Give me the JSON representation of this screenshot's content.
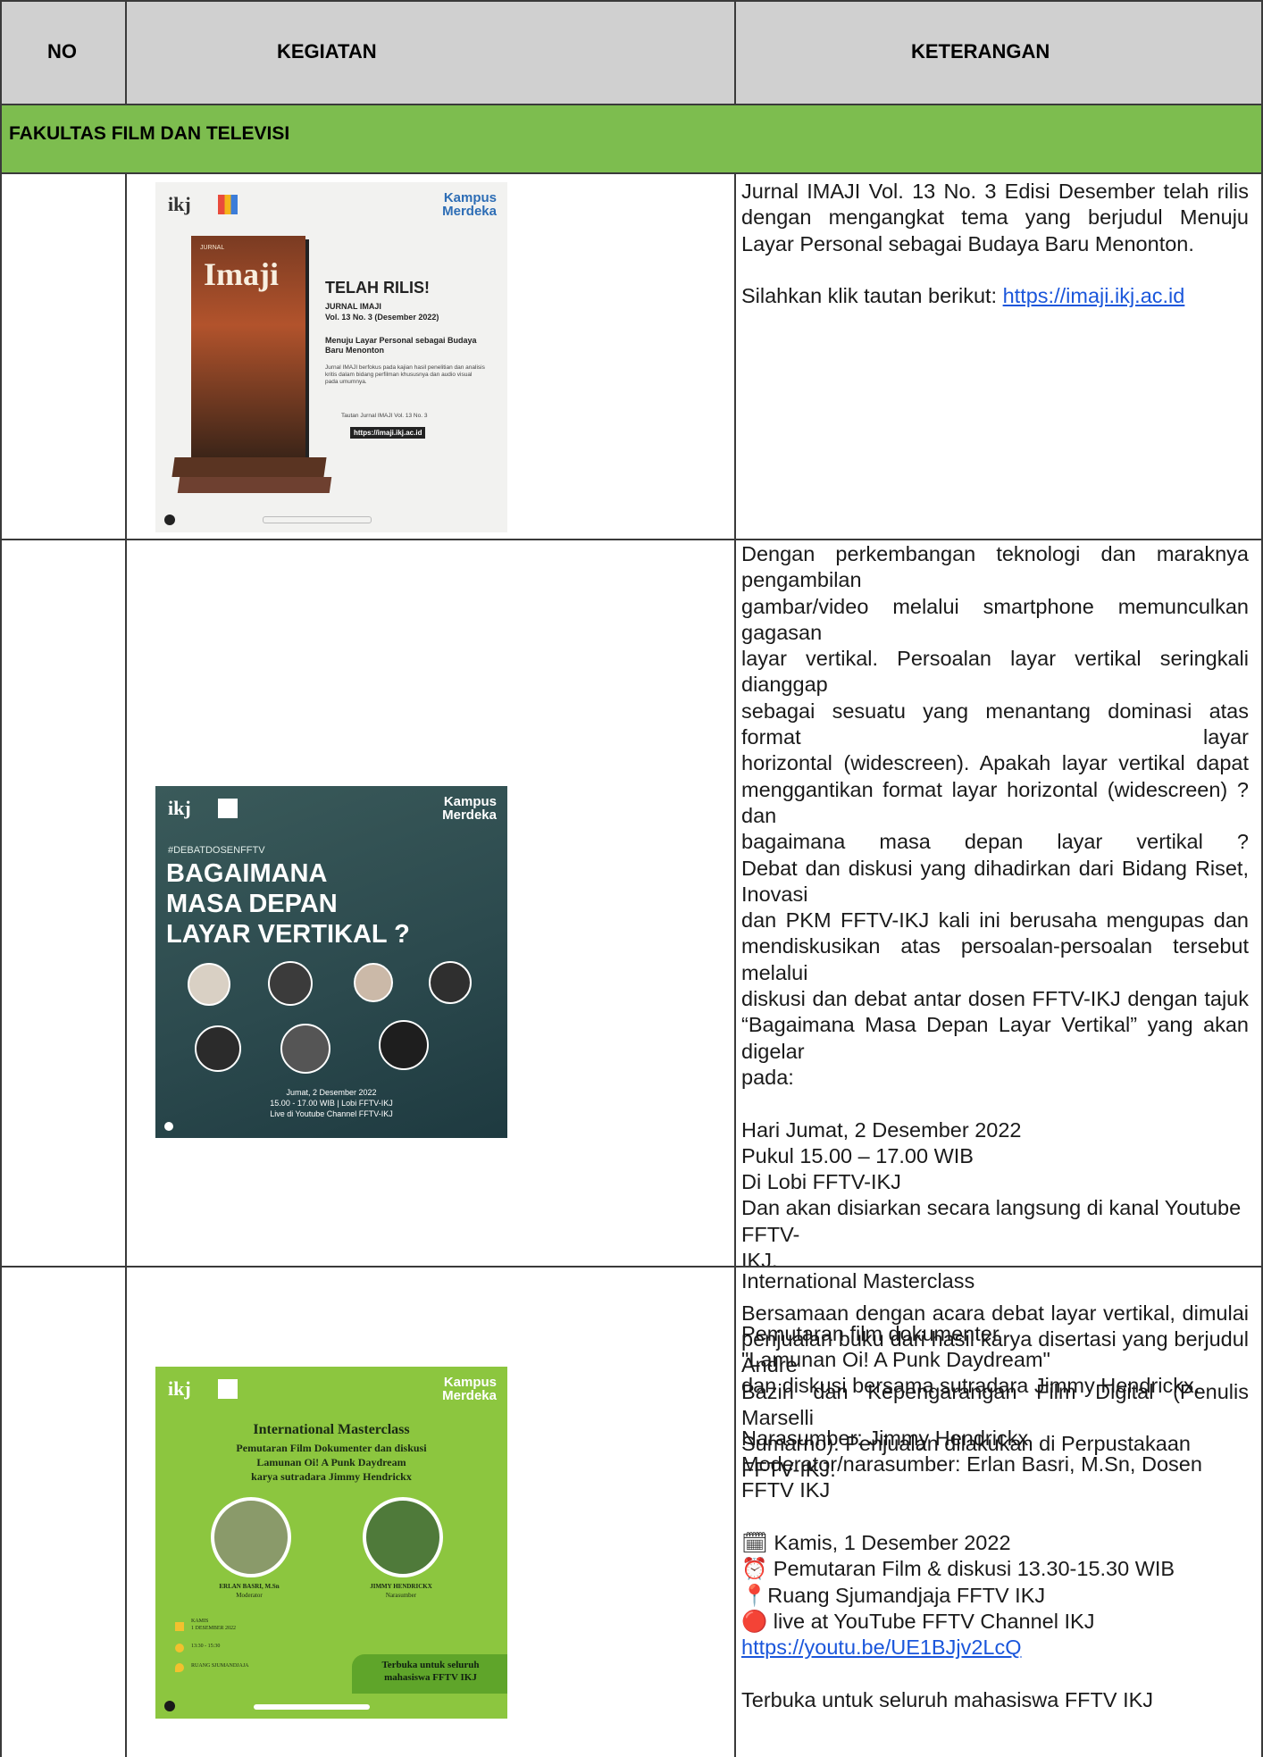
{
  "header": {
    "no": "NO",
    "kegiatan": "KEGIATAN",
    "keterangan": "KETERANGAN"
  },
  "section": {
    "title": "FAKULTAS FILM DAN TELEVISI"
  },
  "row1": {
    "para": "Jurnal IMAJI Vol. 13 No. 3 Edisi Desember telah rilis dengan mengangkat tema yang berjudul Menuju Layar Personal sebagai Budaya Baru Menonton.",
    "link_prefix": "Silahkan klik tautan berikut: ",
    "link": "https://imaji.ikj.ac.id",
    "poster": {
      "logo": "ikj",
      "badge_top": "Kampus",
      "badge_bottom": "Merdeka",
      "journal_small": "JURNAL",
      "journal_title": "Imaji",
      "headline": "TELAH RILIS!",
      "sub1": "JURNAL IMAJI",
      "sub2": "Vol. 13 No. 3 (Desember 2022)",
      "theme": "Menuju Layar Personal sebagai Budaya Baru Menonton",
      "blurb": "Jurnal IMAJI berfokus pada kajian hasil penelitian dan analisis kritis dalam bidang perfilman khususnya dan audio visual pada umumnya.",
      "tautan": "Tautan Jurnal IMAJI Vol. 13 No. 3",
      "url_box": "https://imaji.ikj.ac.id"
    }
  },
  "row2": {
    "lines": [
      "Dengan perkembangan teknologi dan maraknya pengambilan",
      "gambar/video melalui smartphone memunculkan gagasan",
      "layar vertikal. Persoalan layar vertikal seringkali dianggap",
      "sebagai sesuatu yang menantang dominasi atas format layar",
      "horizontal (widescreen). Apakah layar vertikal dapat",
      "menggantikan format layar horizontal (widescreen) ? dan",
      "bagaimana masa depan layar vertikal ?",
      "Debat dan diskusi yang dihadirkan dari Bidang Riset, Inovasi",
      "dan PKM FFTV-IKJ kali ini berusaha mengupas dan",
      "mendiskusikan atas persoalan-persoalan tersebut melalui",
      "diskusi dan debat antar dosen FFTV-IKJ dengan tajuk",
      "“Bagaimana Masa Depan Layar Vertikal” yang akan digelar",
      "pada:"
    ],
    "schedule": [
      "Hari Jumat, 2 Desember 2022",
      "Pukul 15.00 – 17.00 WIB",
      "Di Lobi FFTV-IKJ",
      "Dan akan disiarkan secara langsung di kanal Youtube FFTV-",
      "IKJ."
    ],
    "closing": [
      "Bersamaan dengan acara debat layar vertikal, dimulai",
      "penjualan buku dari hasil karya disertasi yang berjudul Andre",
      "Bazin dan Kepengarangan Film Digital (Penulis Marselli",
      "Sumarno). Penjualan dilakukan di Perpustakaan FFTV-IKJ."
    ],
    "poster": {
      "hashtag": "#DEBATDOSENFFTV",
      "title1": "BAGAIMANA",
      "title2": "MASA DEPAN",
      "title3": "LAYAR VERTIKAL ?",
      "date": "Jumat, 2 Desember 2022",
      "time": "15.00 - 17.00 WIB | Lobi FFTV-IKJ",
      "live": "Live di Youtube Channel FFTV-IKJ"
    }
  },
  "row3": {
    "title": "International Masterclass",
    "lines1": [
      "Pemutaran film dokumenter",
      "\"Lamunan Oi! A Punk Daydream\"",
      "dan diskusi bersama sutradara Jimmy Hendrickx."
    ],
    "lines2": [
      "Narasumber: Jimmy Hendrickx",
      "Moderator/narasumber: Erlan Basri, M.Sn, Dosen FFTV IKJ"
    ],
    "lines3": [
      "🗓 Kamis, 1 Desember 2022",
      "⏰ Pemutaran Film & diskusi 13.30-15.30 WIB",
      "📍Ruang Sjumandjaja FFTV IKJ",
      "🔴 live at YouTube FFTV Channel IKJ"
    ],
    "link": "https://youtu.be/UE1BJjv2LcQ",
    "last": "Terbuka untuk seluruh mahasiswa FFTV IKJ",
    "poster": {
      "title": "International Masterclass",
      "sub1": "Pemutaran Film Dokumenter dan diskusi",
      "sub2": "Lamunan Oi! A Punk Daydream",
      "sub3": "karya sutradara Jimmy Hendrickx",
      "p1_name": "ERLAN BASRI, M.Sn",
      "p1_role": "Moderator",
      "p2_name": "JIMMY HENDRICKX",
      "p2_role": "Narasumber",
      "day": "KAMIS",
      "date": "1 DESEMBER 2022",
      "time": "13:30 - 15:30",
      "place": "RUANG SJUMANDJAJA",
      "open1": "Terbuka untuk seluruh",
      "open2": "mahasiswa FFTV IKJ"
    }
  }
}
